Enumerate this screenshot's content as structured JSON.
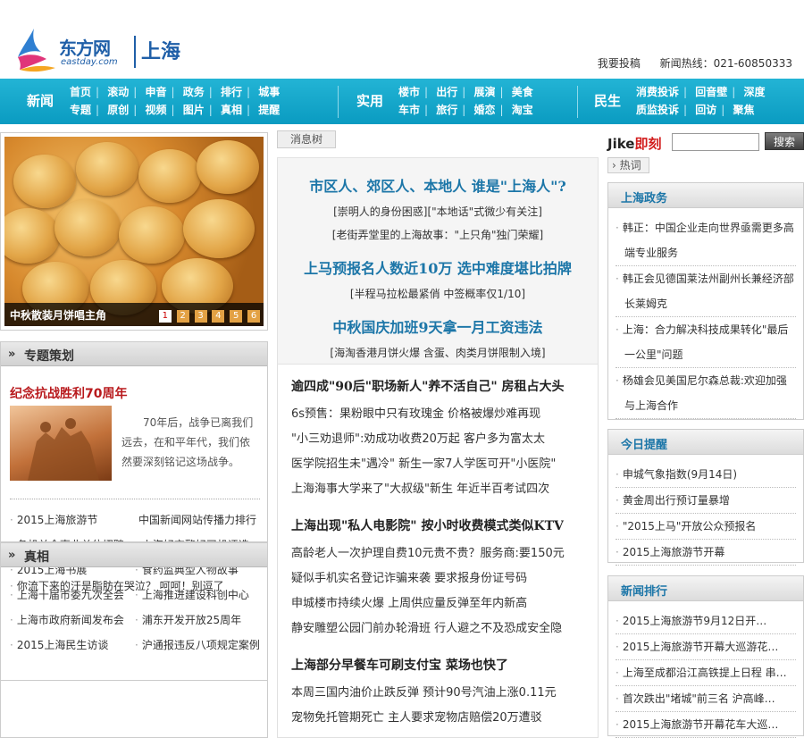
{
  "header": {
    "brand": "东方网",
    "domain": "eastday.com",
    "city": "上海",
    "links": [
      "我要投稿",
      "新闻热线：021-60850333"
    ]
  },
  "nav": {
    "sections": [
      {
        "title": "新闻",
        "row1": [
          "首页",
          "滚动",
          "申音",
          "政务",
          "排行",
          "城事"
        ],
        "row2": [
          "专题",
          "原创",
          "视频",
          "图片",
          "真相",
          "提醒"
        ]
      },
      {
        "title": "实用",
        "row1": [
          "楼市",
          "出行",
          "展演",
          "美食"
        ],
        "row2": [
          "车市",
          "旅行",
          "婚恋",
          "淘宝"
        ]
      },
      {
        "title": "民生",
        "row1": [
          "消费投诉",
          "回音壁",
          "深度"
        ],
        "row2": [
          "质监投诉",
          "回访",
          "聚焦"
        ]
      }
    ]
  },
  "slideshow": {
    "caption": "中秋散装月饼唱主角",
    "pages": [
      "1",
      "2",
      "3",
      "4",
      "5",
      "6"
    ],
    "active": "1"
  },
  "special": {
    "title": "专题策划",
    "topic": "纪念抗战胜利70周年",
    "desc": "70年后，战争已离我们远去，在和平年代，我们依然要深刻铭记这场战争。",
    "items": [
      "2015上海旅游节",
      "中国新闻网站传播力排行",
      "各机关企事业单位招聘",
      "上海好交警好司机评选",
      "2015上海书展",
      "食药监典型人物故事",
      "上海十届市委九次全会",
      "上海推进建设科创中心",
      "上海市政府新闻发布会",
      "浦东开发开放25周年",
      "2015上海民生访谈",
      "沪通报违反八项规定案例"
    ]
  },
  "zhenxiang": {
    "title": "真相",
    "item": "你流下来的汗是脂肪在哭泣？ 呵呵！别逗了"
  },
  "middle": {
    "tab": "消息树",
    "headlines": [
      {
        "title": "市区人、郊区人、本地人 谁是\"上海人\"?",
        "subs": [
          "[崇明人的身份困惑][\"本地话\"式微少有关注]",
          "[老街弄堂里的上海故事：\"上只角\"独门荣耀]"
        ]
      },
      {
        "title": "上马预报名人数近10万 选中难度堪比拍牌",
        "subs": [
          "[半程马拉松最紧俏 中签概率仅1/10]"
        ]
      },
      {
        "title": "中秋国庆加班9天拿一月工资违法",
        "subs": [
          "[海淘香港月饼火爆 含蛋、肉类月饼限制入境]"
        ]
      }
    ],
    "groups": [
      {
        "title": "逾四成\"90后\"职场新人\"养不活自己\" 房租占大头",
        "lines": [
          "6s预售：果粉眼中只有玫瑰金 价格被爆炒难再现",
          "\"小三劝退师\":劝成功收费20万起 客户多为富太太",
          "医学院招生未\"遇冷\" 新生一家7人学医可开\"小医院\"",
          "上海海事大学来了\"大叔级\"新生 年近半百考试四次"
        ]
      },
      {
        "title": "上海出现\"私人电影院\" 按小时收费模式类似KTV",
        "lines": [
          "高龄老人一次护理自费10元贵不贵？服务商:要150元",
          "疑似手机实名登记诈骗来袭 要求报身份证号码",
          "申城楼市持续火爆 上周供应量反弹至年内新高",
          "静安雕塑公园门前办轮滑班 行人避之不及恐成安全隐"
        ]
      },
      {
        "title": "上海部分早餐车可刷支付宝 菜场也快了",
        "lines": [
          "本周三国内油价止跌反弹 预计90号汽油上涨0.11元",
          "宠物免托管期死亡 主人要求宠物店赔偿20万遭驳"
        ]
      }
    ]
  },
  "right": {
    "jike_j": "Jike",
    "jike_k": "即刻",
    "search_button": "搜索",
    "hot_label": "热词",
    "boxes": [
      {
        "title": "上海政务",
        "items": [
          "韩正：中国企业走向世界亟需更多高端专业服务",
          "韩正会见德国莱法州副州长兼经济部长莱姆克",
          "上海：合力解决科技成果转化\"最后一公里\"问题",
          "杨雄会见美国尼尔森总裁:欢迎加强与上海合作"
        ]
      },
      {
        "title": "今日提醒",
        "items": [
          "申城气象指数(9月14日)",
          "黄金周出行预订量暴增",
          "\"2015上马\"开放公众预报名",
          "2015上海旅游节开幕"
        ]
      },
      {
        "title": "新闻排行",
        "items": [
          "2015上海旅游节9月12日开…",
          "2015上海旅游节开幕大巡游花…",
          "上海至成都沿江高铁提上日程 串…",
          "首次跌出\"堵城\"前三名 沪高峰…",
          "2015上海旅游节开幕花车大巡…"
        ]
      }
    ]
  }
}
